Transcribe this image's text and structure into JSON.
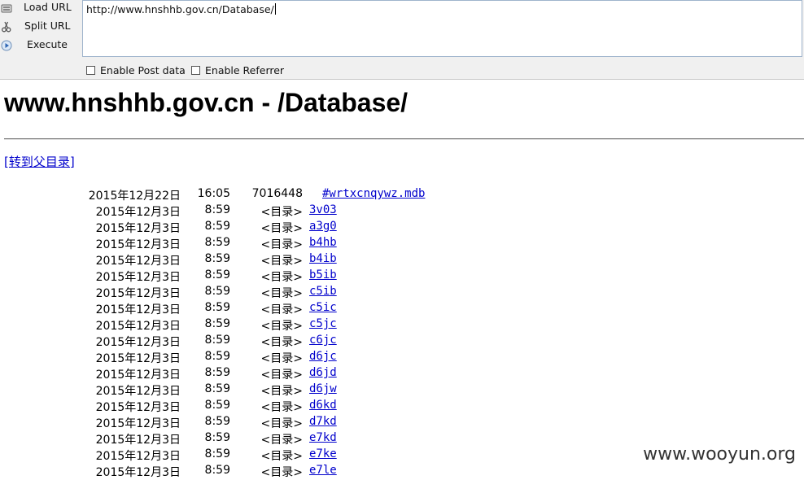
{
  "toolbar": {
    "load_url": "Load URL",
    "split_url": "Split URL",
    "execute": "Execute",
    "url_value": "http://www.hnshhb.gov.cn/Database/",
    "enable_post": "Enable Post data",
    "enable_referrer": "Enable Referrer"
  },
  "page": {
    "title": "www.hnshhb.gov.cn - /Database/",
    "parent_link": "[转到父目录]"
  },
  "listing": [
    {
      "date": "2015年12月22日",
      "time": "16:05",
      "size": "7016448",
      "name": "#wrtxcnqywz.mdb",
      "type": "file"
    },
    {
      "date": "2015年12月3日",
      "time": "8:59",
      "size": "<目录>",
      "name": "3v03",
      "type": "dir"
    },
    {
      "date": "2015年12月3日",
      "time": "8:59",
      "size": "<目录>",
      "name": "a3g0",
      "type": "dir"
    },
    {
      "date": "2015年12月3日",
      "time": "8:59",
      "size": "<目录>",
      "name": "b4hb",
      "type": "dir"
    },
    {
      "date": "2015年12月3日",
      "time": "8:59",
      "size": "<目录>",
      "name": "b4ib",
      "type": "dir"
    },
    {
      "date": "2015年12月3日",
      "time": "8:59",
      "size": "<目录>",
      "name": "b5ib",
      "type": "dir"
    },
    {
      "date": "2015年12月3日",
      "time": "8:59",
      "size": "<目录>",
      "name": "c5ib",
      "type": "dir"
    },
    {
      "date": "2015年12月3日",
      "time": "8:59",
      "size": "<目录>",
      "name": "c5ic",
      "type": "dir"
    },
    {
      "date": "2015年12月3日",
      "time": "8:59",
      "size": "<目录>",
      "name": "c5jc",
      "type": "dir"
    },
    {
      "date": "2015年12月3日",
      "time": "8:59",
      "size": "<目录>",
      "name": "c6jc",
      "type": "dir"
    },
    {
      "date": "2015年12月3日",
      "time": "8:59",
      "size": "<目录>",
      "name": "d6jc",
      "type": "dir"
    },
    {
      "date": "2015年12月3日",
      "time": "8:59",
      "size": "<目录>",
      "name": "d6jd",
      "type": "dir"
    },
    {
      "date": "2015年12月3日",
      "time": "8:59",
      "size": "<目录>",
      "name": "d6jw",
      "type": "dir"
    },
    {
      "date": "2015年12月3日",
      "time": "8:59",
      "size": "<目录>",
      "name": "d6kd",
      "type": "dir"
    },
    {
      "date": "2015年12月3日",
      "time": "8:59",
      "size": "<目录>",
      "name": "d7kd",
      "type": "dir"
    },
    {
      "date": "2015年12月3日",
      "time": "8:59",
      "size": "<目录>",
      "name": "e7kd",
      "type": "dir"
    },
    {
      "date": "2015年12月3日",
      "time": "8:59",
      "size": "<目录>",
      "name": "e7ke",
      "type": "dir"
    },
    {
      "date": "2015年12月3日",
      "time": "8:59",
      "size": "<目录>",
      "name": "e7le",
      "type": "dir"
    }
  ],
  "watermark": "www.wooyun.org"
}
